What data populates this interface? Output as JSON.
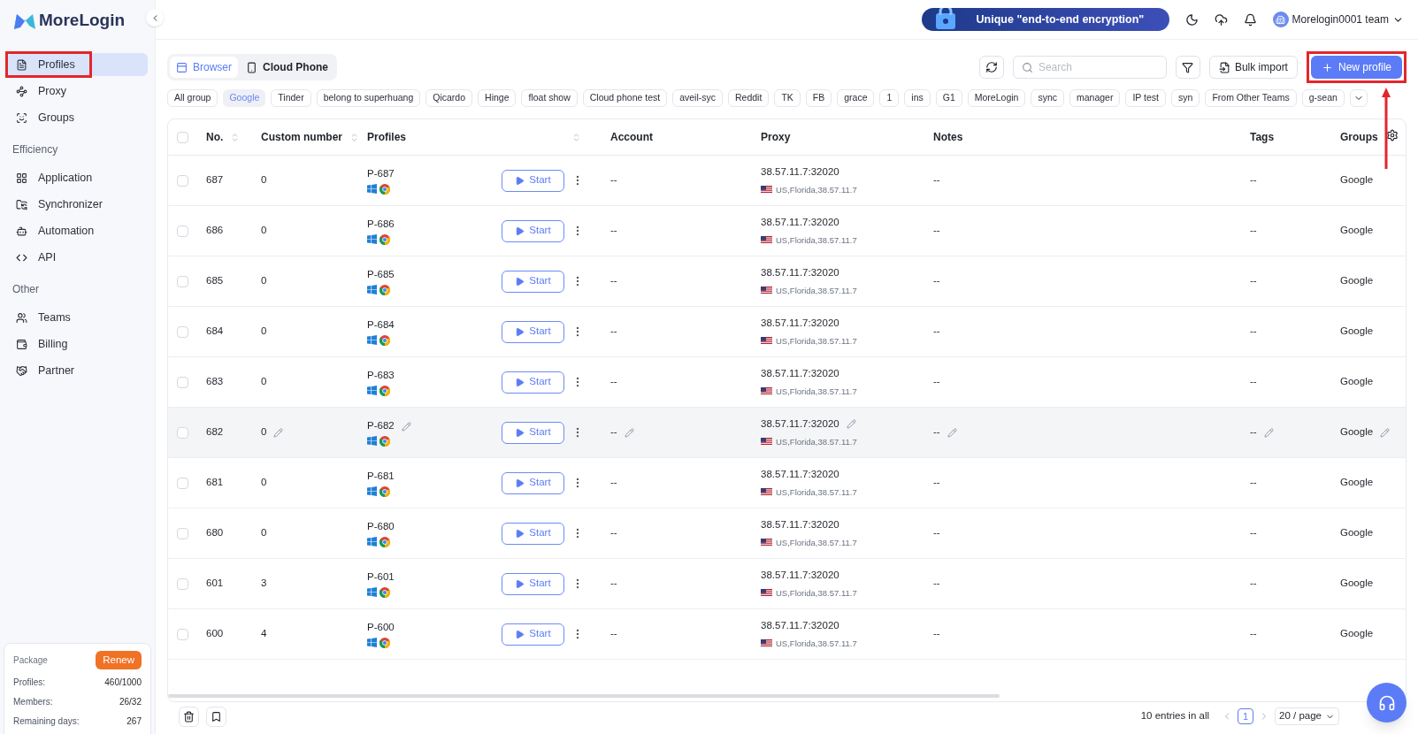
{
  "brand": "MoreLogin",
  "sidebar": {
    "sections": [
      {
        "items": [
          {
            "kind": "profiles",
            "label": "Profiles",
            "selected": true,
            "highlighted": true
          },
          {
            "kind": "proxy",
            "label": "Proxy",
            "selected": false,
            "highlighted": false
          },
          {
            "kind": "groups",
            "label": "Groups",
            "selected": false,
            "highlighted": false
          }
        ]
      },
      {
        "title": "Efficiency",
        "items": [
          {
            "kind": "application",
            "label": "Application",
            "selected": false,
            "highlighted": false
          },
          {
            "kind": "synchronizer",
            "label": "Synchronizer",
            "selected": false,
            "highlighted": false
          },
          {
            "kind": "automation",
            "label": "Automation",
            "selected": false,
            "highlighted": false
          },
          {
            "kind": "api",
            "label": "API",
            "selected": false,
            "highlighted": false
          }
        ]
      },
      {
        "title": "Other",
        "items": [
          {
            "kind": "teams",
            "label": "Teams",
            "selected": false,
            "highlighted": false
          },
          {
            "kind": "billing",
            "label": "Billing",
            "selected": false,
            "highlighted": false
          },
          {
            "kind": "partner",
            "label": "Partner",
            "selected": false,
            "highlighted": false
          }
        ]
      }
    ],
    "package": {
      "title": "Package",
      "button": "Renew",
      "rows": [
        {
          "label": "Profiles:",
          "value": "460/1000"
        },
        {
          "label": "Members:",
          "value": "26/32"
        },
        {
          "label": "Remaining days:",
          "value": "267"
        }
      ]
    }
  },
  "header": {
    "promo": "Unique \"end-to-end encryption\"",
    "team": "Morelogin0001 team"
  },
  "tabs": [
    {
      "kind": "browser",
      "label": "Browser",
      "selected": true
    },
    {
      "kind": "phone",
      "label": "Cloud Phone",
      "selected": false
    }
  ],
  "toolbar": {
    "search": {
      "placeholder": "Search"
    },
    "bulk_import": "Bulk import",
    "new_profile": {
      "label": "New profile",
      "highlighted": true
    }
  },
  "groups": [
    {
      "label": "All group",
      "selected": false
    },
    {
      "label": "Google",
      "selected": true
    },
    {
      "label": "Tinder",
      "selected": false
    },
    {
      "label": "belong to superhuang",
      "selected": false
    },
    {
      "label": "Qicardo",
      "selected": false
    },
    {
      "label": "Hinge",
      "selected": false
    },
    {
      "label": "float show",
      "selected": false
    },
    {
      "label": "Cloud phone test",
      "selected": false
    },
    {
      "label": "aveil-syc",
      "selected": false
    },
    {
      "label": "Reddit",
      "selected": false
    },
    {
      "label": "TK",
      "selected": false
    },
    {
      "label": "FB",
      "selected": false
    },
    {
      "label": "grace",
      "selected": false
    },
    {
      "label": "1",
      "selected": false
    },
    {
      "label": "ins",
      "selected": false
    },
    {
      "label": "G1",
      "selected": false
    },
    {
      "label": "MoreLogin",
      "selected": false
    },
    {
      "label": "sync",
      "selected": false
    },
    {
      "label": "manager",
      "selected": false
    },
    {
      "label": "IP test",
      "selected": false
    },
    {
      "label": "syn",
      "selected": false
    },
    {
      "label": "From Other Teams",
      "selected": false
    },
    {
      "label": "g-sean",
      "selected": false
    }
  ],
  "table": {
    "all_checked": false,
    "columns": [
      {
        "label": "No.",
        "sortable": true
      },
      {
        "label": "Custom number",
        "sortable": true
      },
      {
        "label": "Profiles",
        "sortable": true
      },
      {
        "label": "Account",
        "sortable": false
      },
      {
        "label": "Proxy",
        "sortable": false
      },
      {
        "label": "Notes",
        "sortable": false
      },
      {
        "label": "Tags",
        "sortable": false
      },
      {
        "label": "Groups",
        "sortable": false
      }
    ],
    "rows": [
      {
        "checked": false,
        "no": "687",
        "custom": "0",
        "profile": "P-687",
        "start": "Start",
        "account": "--",
        "proxy": "38.57.11.7:32020",
        "location": "US,Florida,38.57.11.7",
        "notes": "--",
        "tags": "--",
        "group": "Google",
        "hovered": false
      },
      {
        "checked": false,
        "no": "686",
        "custom": "0",
        "profile": "P-686",
        "start": "Start",
        "account": "--",
        "proxy": "38.57.11.7:32020",
        "location": "US,Florida,38.57.11.7",
        "notes": "--",
        "tags": "--",
        "group": "Google",
        "hovered": false
      },
      {
        "checked": false,
        "no": "685",
        "custom": "0",
        "profile": "P-685",
        "start": "Start",
        "account": "--",
        "proxy": "38.57.11.7:32020",
        "location": "US,Florida,38.57.11.7",
        "notes": "--",
        "tags": "--",
        "group": "Google",
        "hovered": false
      },
      {
        "checked": false,
        "no": "684",
        "custom": "0",
        "profile": "P-684",
        "start": "Start",
        "account": "--",
        "proxy": "38.57.11.7:32020",
        "location": "US,Florida,38.57.11.7",
        "notes": "--",
        "tags": "--",
        "group": "Google",
        "hovered": false
      },
      {
        "checked": false,
        "no": "683",
        "custom": "0",
        "profile": "P-683",
        "start": "Start",
        "account": "--",
        "proxy": "38.57.11.7:32020",
        "location": "US,Florida,38.57.11.7",
        "notes": "--",
        "tags": "--",
        "group": "Google",
        "hovered": false
      },
      {
        "checked": false,
        "no": "682",
        "custom": "0",
        "profile": "P-682",
        "start": "Start",
        "account": "--",
        "proxy": "38.57.11.7:32020",
        "location": "US,Florida,38.57.11.7",
        "notes": "--",
        "tags": "--",
        "group": "Google",
        "hovered": true
      },
      {
        "checked": false,
        "no": "681",
        "custom": "0",
        "profile": "P-681",
        "start": "Start",
        "account": "--",
        "proxy": "38.57.11.7:32020",
        "location": "US,Florida,38.57.11.7",
        "notes": "--",
        "tags": "--",
        "group": "Google",
        "hovered": false
      },
      {
        "checked": false,
        "no": "680",
        "custom": "0",
        "profile": "P-680",
        "start": "Start",
        "account": "--",
        "proxy": "38.57.11.7:32020",
        "location": "US,Florida,38.57.11.7",
        "notes": "--",
        "tags": "--",
        "group": "Google",
        "hovered": false
      },
      {
        "checked": false,
        "no": "601",
        "custom": "3",
        "profile": "P-601",
        "start": "Start",
        "account": "--",
        "proxy": "38.57.11.7:32020",
        "location": "US,Florida,38.57.11.7",
        "notes": "--",
        "tags": "--",
        "group": "Google",
        "hovered": false
      },
      {
        "checked": false,
        "no": "600",
        "custom": "4",
        "profile": "P-600",
        "start": "Start",
        "account": "--",
        "proxy": "38.57.11.7:32020",
        "location": "US,Florida,38.57.11.7",
        "notes": "--",
        "tags": "--",
        "group": "Google",
        "hovered": false
      }
    ]
  },
  "footer": {
    "total": "10 entries in all",
    "pages": [
      {
        "label": "1",
        "selected": true
      }
    ],
    "page_size": "20 / page"
  }
}
